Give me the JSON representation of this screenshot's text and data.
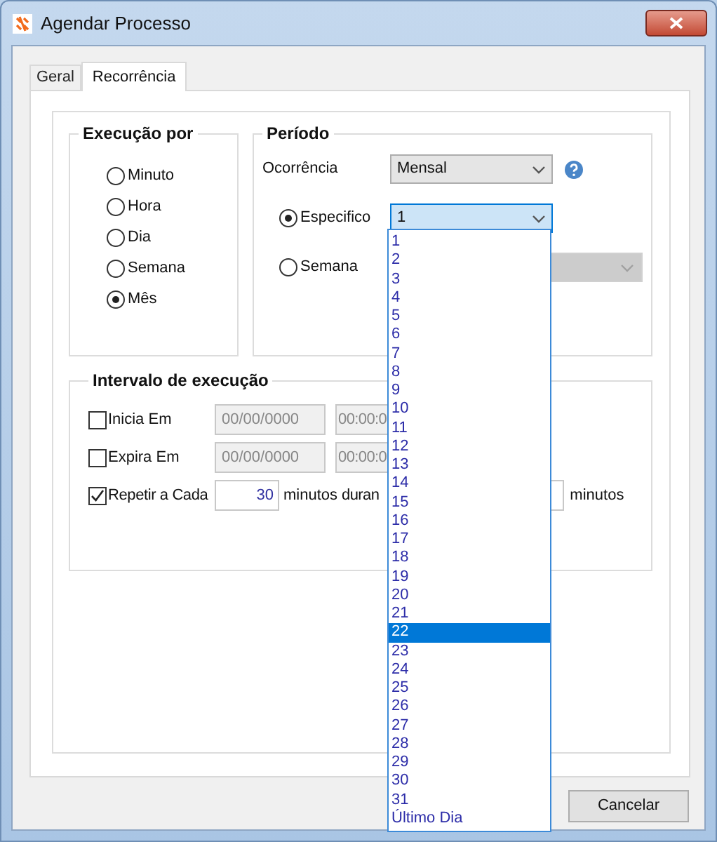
{
  "window": {
    "title": "Agendar Processo"
  },
  "tabs": [
    {
      "label": "Geral",
      "selected": false
    },
    {
      "label": "Recorrência",
      "selected": true
    }
  ],
  "execucao": {
    "title": "Execução por",
    "options": [
      {
        "label": "Minuto",
        "selected": false
      },
      {
        "label": "Hora",
        "selected": false
      },
      {
        "label": "Dia",
        "selected": false
      },
      {
        "label": "Semana",
        "selected": false
      },
      {
        "label": "Mês",
        "selected": true
      }
    ]
  },
  "periodo": {
    "title": "Período",
    "ocorrencia": {
      "label": "Ocorrência",
      "value": "Mensal"
    },
    "options": [
      {
        "label": "Especifico",
        "selected": true,
        "value": "1"
      },
      {
        "label": "Semana",
        "selected": false
      }
    ]
  },
  "intervalo": {
    "title": "Intervalo de execução",
    "rows": [
      {
        "kind": "dates",
        "label": "Inicia Em",
        "checked": false,
        "date": "00/00/0000",
        "time": "00:00:0"
      },
      {
        "kind": "dates",
        "label": "Expira Em",
        "checked": false,
        "date": "00/00/0000",
        "time": "00:00:0"
      },
      {
        "kind": "repeat",
        "label": "Repetir a Cada",
        "checked": true,
        "value": "30",
        "unit": "minutos",
        "during": "duran",
        "unit2": "minutos"
      }
    ]
  },
  "dropdown_list": {
    "items": [
      {
        "label": "1",
        "selected": false
      },
      {
        "label": "2",
        "selected": false
      },
      {
        "label": "3",
        "selected": false
      },
      {
        "label": "4",
        "selected": false
      },
      {
        "label": "5",
        "selected": false
      },
      {
        "label": "6",
        "selected": false
      },
      {
        "label": "7",
        "selected": false
      },
      {
        "label": "8",
        "selected": false
      },
      {
        "label": "9",
        "selected": false
      },
      {
        "label": "10",
        "selected": false
      },
      {
        "label": "11",
        "selected": false
      },
      {
        "label": "12",
        "selected": false
      },
      {
        "label": "13",
        "selected": false
      },
      {
        "label": "14",
        "selected": false
      },
      {
        "label": "15",
        "selected": false
      },
      {
        "label": "16",
        "selected": false
      },
      {
        "label": "17",
        "selected": false
      },
      {
        "label": "18",
        "selected": false
      },
      {
        "label": "19",
        "selected": false
      },
      {
        "label": "20",
        "selected": false
      },
      {
        "label": "21",
        "selected": false
      },
      {
        "label": "22",
        "selected": true
      },
      {
        "label": "23",
        "selected": false
      },
      {
        "label": "24",
        "selected": false
      },
      {
        "label": "25",
        "selected": false
      },
      {
        "label": "26",
        "selected": false
      },
      {
        "label": "27",
        "selected": false
      },
      {
        "label": "28",
        "selected": false
      },
      {
        "label": "29",
        "selected": false
      },
      {
        "label": "30",
        "selected": false
      },
      {
        "label": "31",
        "selected": false
      },
      {
        "label": "Último Dia",
        "selected": false
      }
    ]
  },
  "buttons": [
    {
      "label": "Cancelar"
    }
  ]
}
